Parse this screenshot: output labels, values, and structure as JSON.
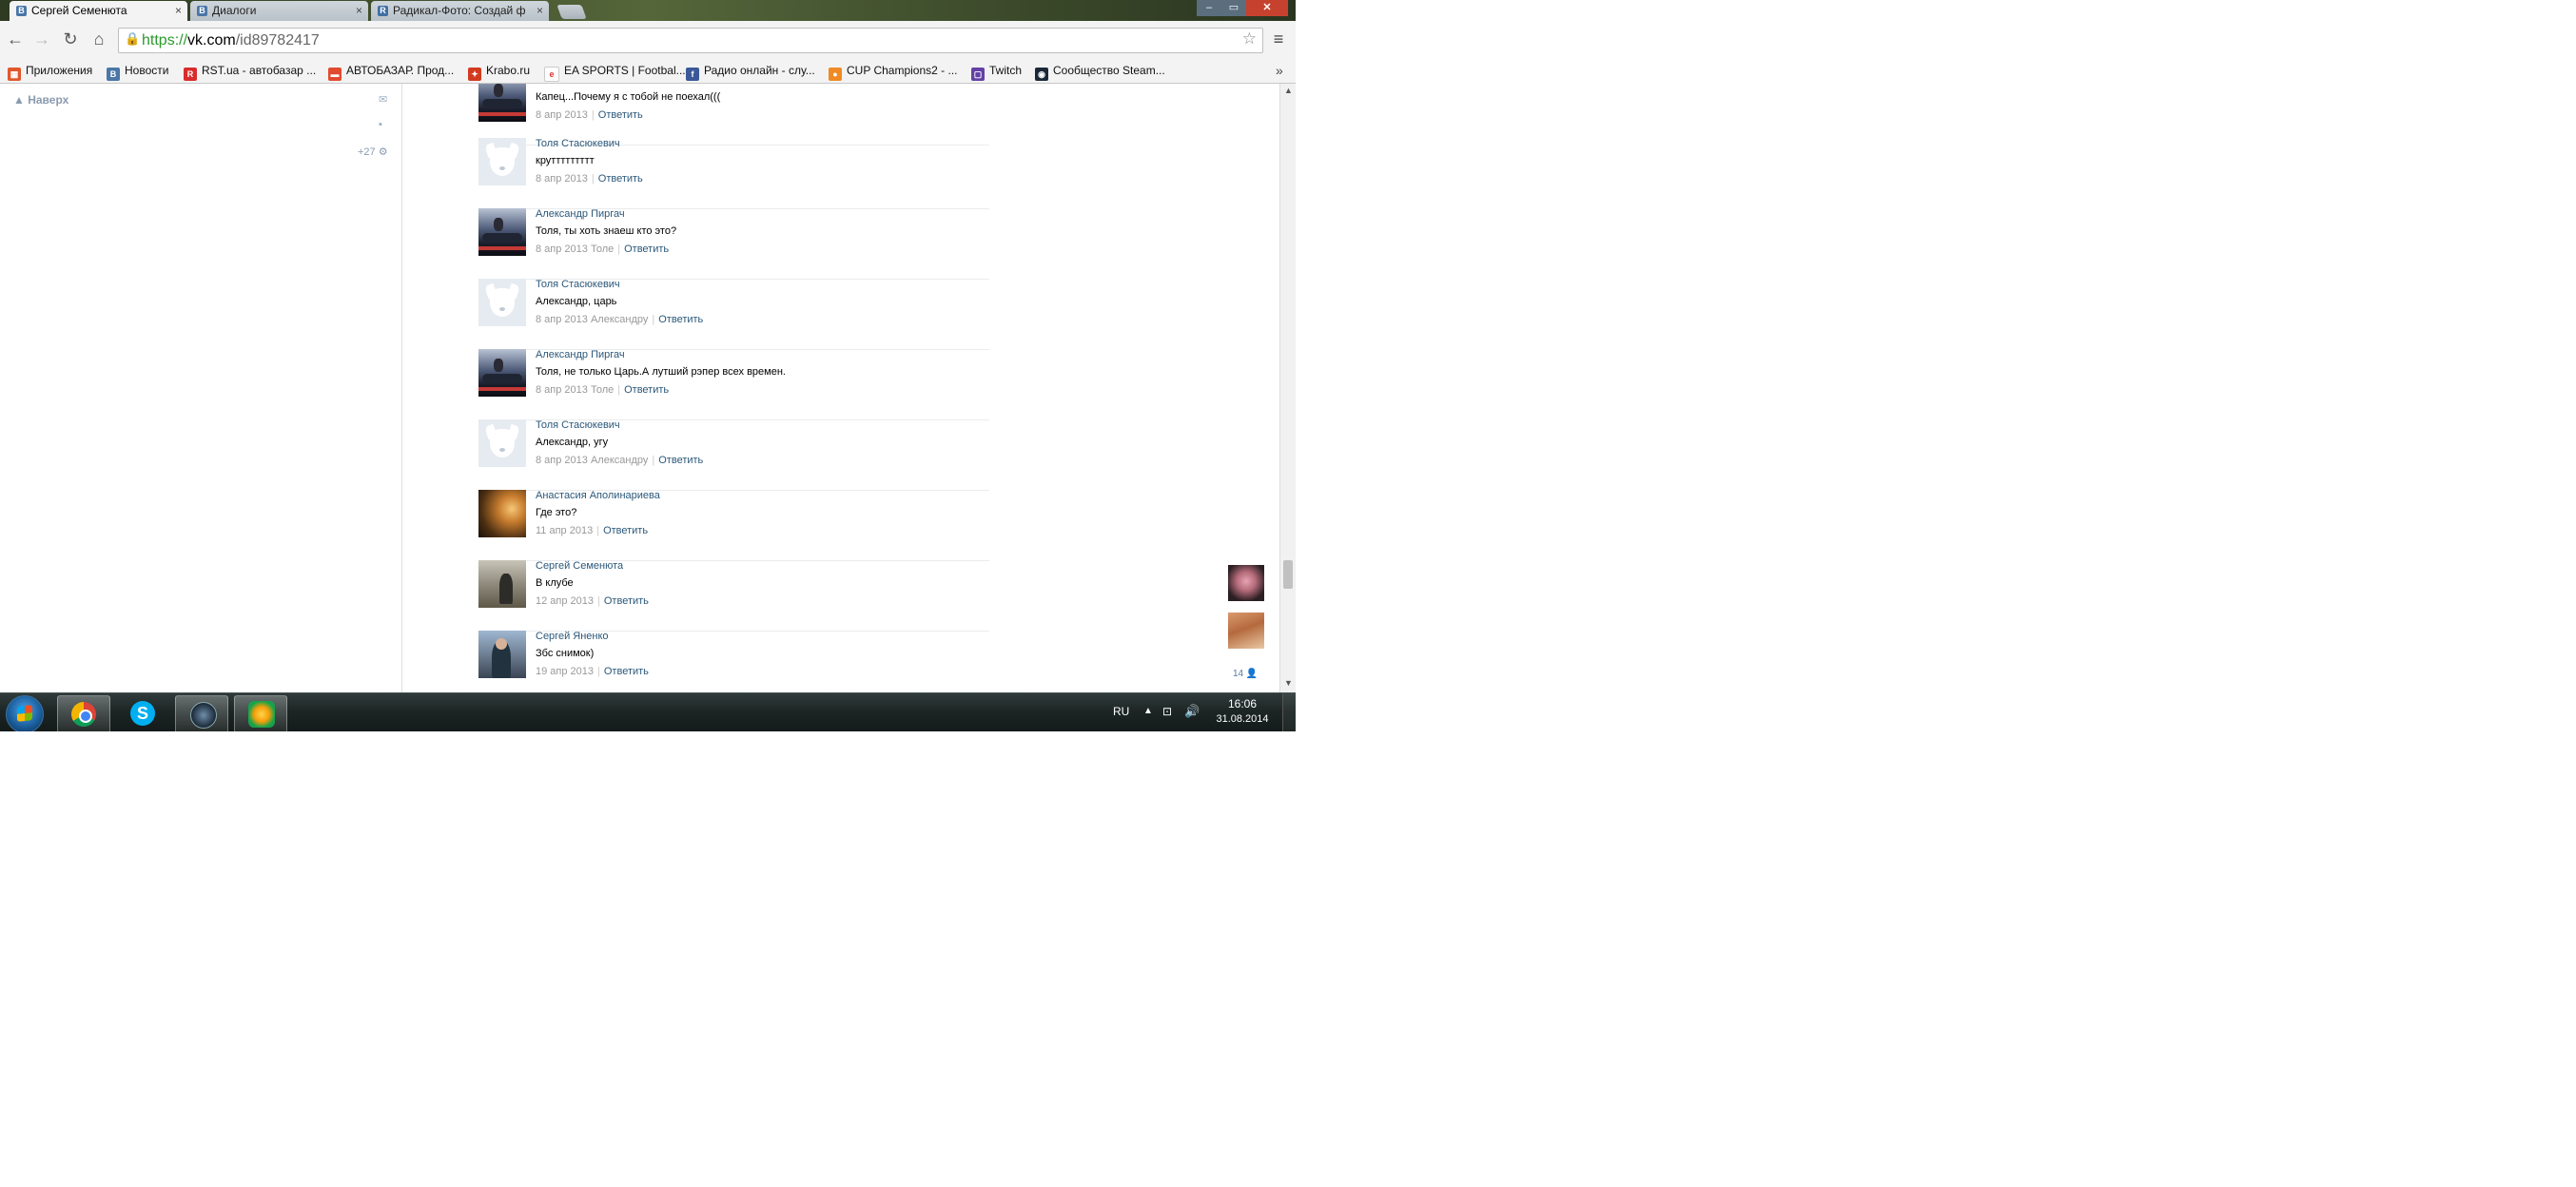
{
  "browser": {
    "tabs": [
      {
        "label": "Сергей Семенюта",
        "favicon": "vk-icon",
        "active": true
      },
      {
        "label": "Диалоги",
        "favicon": "vk-icon",
        "active": false
      },
      {
        "label": "Радикал-Фото: Создай ф",
        "favicon": "radikal-icon",
        "active": false
      }
    ],
    "tab_close": "×",
    "window_controls": {
      "minimize": "–",
      "maximize": "▭",
      "close": "✕"
    },
    "url": {
      "scheme": "https://",
      "host": "vk.com",
      "path": "/id89782417"
    },
    "bookmarks": [
      {
        "label": "Приложения",
        "icon": "apps-grid-icon",
        "color": "#e0572b"
      },
      {
        "label": "Новости",
        "icon": "vk-icon",
        "color": "#4a76a8"
      },
      {
        "label": "RST.ua - автобазар ...",
        "icon": "rst-icon",
        "color": "#d92b2b"
      },
      {
        "label": "АВТОБАЗАР. Прод...",
        "icon": "car-icon",
        "color": "#e14b2f"
      },
      {
        "label": "Krabo.ru",
        "icon": "krabo-icon",
        "color": "#d23b1f"
      },
      {
        "label": "EA SPORTS | Footbal...",
        "icon": "ea-icon",
        "color": "#ffffff"
      },
      {
        "label": "Радио онлайн - слу...",
        "icon": "facebook-icon",
        "color": "#3b5998"
      },
      {
        "label": "CUP Champions2 - ...",
        "icon": "cup-icon",
        "color": "#f08a24"
      },
      {
        "label": "Twitch",
        "icon": "twitch-icon",
        "color": "#6441a5"
      },
      {
        "label": "Сообщество Steam...",
        "icon": "steam-icon",
        "color": "#1b2838"
      }
    ],
    "bookmarks_more": "»"
  },
  "sidebar": {
    "to_top": "Наверх",
    "count": "+27"
  },
  "comments": [
    {
      "author": "",
      "avatar": "alex",
      "text": "Капец...Почему я с тобой не поехал(((",
      "date": "8 апр 2013",
      "reply_to": "",
      "reply": "Ответить"
    },
    {
      "author": "Толя Стасюкевич",
      "avatar": "dog",
      "text": "круттттттттт",
      "date": "8 апр 2013",
      "reply_to": "",
      "reply": "Ответить"
    },
    {
      "author": "Александр Пиргач",
      "avatar": "alex",
      "text": "Толя, ты хоть знаеш кто это?",
      "date": "8 апр 2013",
      "reply_to": "Толе",
      "reply": "Ответить"
    },
    {
      "author": "Толя Стасюкевич",
      "avatar": "dog",
      "text": "Александр, царь",
      "date": "8 апр 2013",
      "reply_to": "Александру",
      "reply": "Ответить"
    },
    {
      "author": "Александр Пиргач",
      "avatar": "alex",
      "text": "Толя, не только Царь.А лутший рэпер всех времен.",
      "date": "8 апр 2013",
      "reply_to": "Толе",
      "reply": "Ответить"
    },
    {
      "author": "Толя Стасюкевич",
      "avatar": "dog",
      "text": "Александр, угу",
      "date": "8 апр 2013",
      "reply_to": "Александру",
      "reply": "Ответить"
    },
    {
      "author": "Анастасия Аполинариева",
      "avatar": "anast",
      "text": "Где это?",
      "date": "11 апр 2013",
      "reply_to": "",
      "reply": "Ответить"
    },
    {
      "author": "Сергей Семенюта",
      "avatar": "serg",
      "text": "В клубе",
      "date": "12 апр 2013",
      "reply_to": "",
      "reply": "Ответить"
    },
    {
      "author": "Сергей Яненко",
      "avatar": "yan",
      "text": "Збс снимок)",
      "date": "19 апр 2013",
      "reply_to": "",
      "reply": "Ответить"
    }
  ],
  "chat_sidebar": {
    "count": "14"
  },
  "taskbar": {
    "apps": [
      "chrome-icon",
      "skype-icon",
      "steam-icon",
      "app-icon"
    ],
    "lang": "RU",
    "time": "16:06",
    "date": "31.08.2014"
  }
}
